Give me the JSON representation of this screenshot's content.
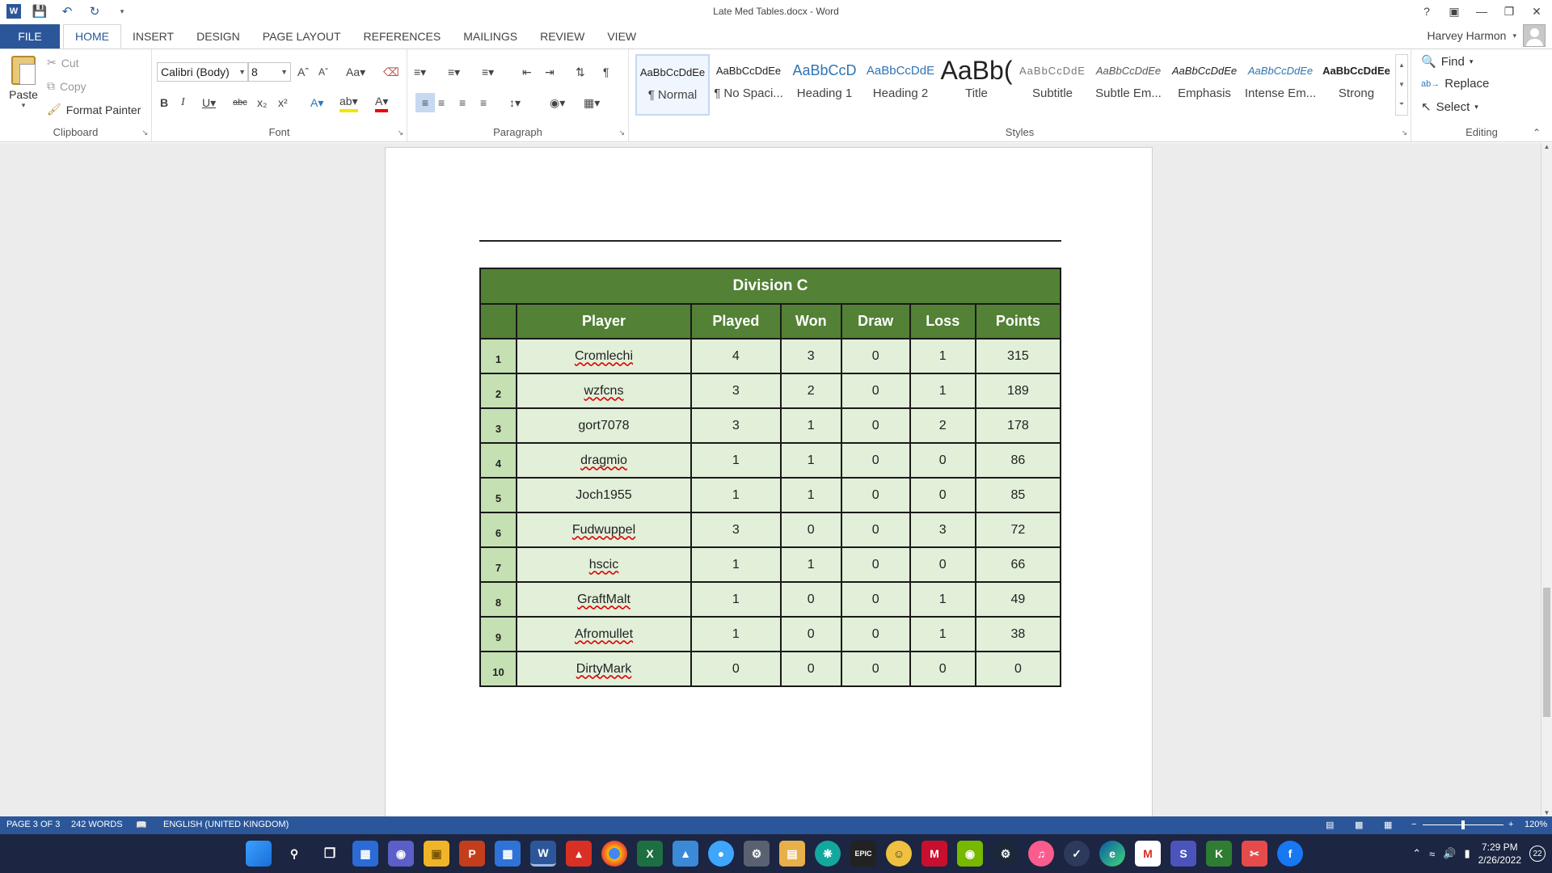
{
  "window": {
    "title": "Late Med Tables.docx - Word"
  },
  "ribbon_tabs": {
    "file": "FILE",
    "tabs": [
      "HOME",
      "INSERT",
      "DESIGN",
      "PAGE LAYOUT",
      "REFERENCES",
      "MAILINGS",
      "REVIEW",
      "VIEW"
    ],
    "active": "HOME"
  },
  "user": {
    "name": "Harvey Harmon"
  },
  "clipboard": {
    "paste": "Paste",
    "cut": "Cut",
    "copy": "Copy",
    "format_painter": "Format Painter",
    "label": "Clipboard"
  },
  "font": {
    "name": "Calibri (Body)",
    "size": "8",
    "label": "Font"
  },
  "paragraph": {
    "label": "Paragraph"
  },
  "styles": {
    "label": "Styles",
    "items": [
      {
        "sample": "AaBbCcDdEe",
        "name": "¶ Normal"
      },
      {
        "sample": "AaBbCcDdEe",
        "name": "¶ No Spaci..."
      },
      {
        "sample": "AaBbCcD",
        "name": "Heading 1"
      },
      {
        "sample": "AaBbCcDdE",
        "name": "Heading 2"
      },
      {
        "sample": "AaBb(",
        "name": "Title"
      },
      {
        "sample": "AaBbCcDdE",
        "name": "Subtitle"
      },
      {
        "sample": "AaBbCcDdEe",
        "name": "Subtle Em..."
      },
      {
        "sample": "AaBbCcDdEe",
        "name": "Emphasis"
      },
      {
        "sample": "AaBbCcDdEe",
        "name": "Intense Em..."
      },
      {
        "sample": "AaBbCcDdEe",
        "name": "Strong"
      }
    ]
  },
  "editing": {
    "find": "Find",
    "replace": "Replace",
    "select": "Select",
    "label": "Editing"
  },
  "table": {
    "title": "Division C",
    "headers": [
      "Player",
      "Played",
      "Won",
      "Draw",
      "Loss",
      "Points"
    ],
    "rows": [
      {
        "rank": "1",
        "player": "Cromlechi",
        "played": "4",
        "won": "3",
        "draw": "0",
        "loss": "1",
        "points": "315"
      },
      {
        "rank": "2",
        "player": "wzfcns",
        "played": "3",
        "won": "2",
        "draw": "0",
        "loss": "1",
        "points": "189"
      },
      {
        "rank": "3",
        "player": "gort7078",
        "played": "3",
        "won": "1",
        "draw": "0",
        "loss": "2",
        "points": "178"
      },
      {
        "rank": "4",
        "player": "dragmio",
        "played": "1",
        "won": "1",
        "draw": "0",
        "loss": "0",
        "points": "86"
      },
      {
        "rank": "5",
        "player": "Joch1955",
        "played": "1",
        "won": "1",
        "draw": "0",
        "loss": "0",
        "points": "85"
      },
      {
        "rank": "6",
        "player": "Fudwuppel",
        "played": "3",
        "won": "0",
        "draw": "0",
        "loss": "3",
        "points": "72"
      },
      {
        "rank": "7",
        "player": "hscic",
        "played": "1",
        "won": "1",
        "draw": "0",
        "loss": "0",
        "points": "66"
      },
      {
        "rank": "8",
        "player": "GraftMalt",
        "played": "1",
        "won": "0",
        "draw": "0",
        "loss": "1",
        "points": "49"
      },
      {
        "rank": "9",
        "player": "Afromullet",
        "played": "1",
        "won": "0",
        "draw": "0",
        "loss": "1",
        "points": "38"
      },
      {
        "rank": "10",
        "player": "DirtyMark",
        "played": "0",
        "won": "0",
        "draw": "0",
        "loss": "0",
        "points": "0"
      }
    ]
  },
  "status": {
    "page": "PAGE 3 OF 3",
    "words": "242 WORDS",
    "language": "ENGLISH (UNITED KINGDOM)",
    "zoom": "120%"
  },
  "taskbar": {
    "time": "7:29 PM",
    "date": "2/26/2022",
    "notifications": "22"
  },
  "colors": {
    "word_blue": "#2b579a",
    "table_header_green": "#538135",
    "table_rank_green": "#c5e0b3",
    "table_cell_green": "#e2efd9"
  }
}
